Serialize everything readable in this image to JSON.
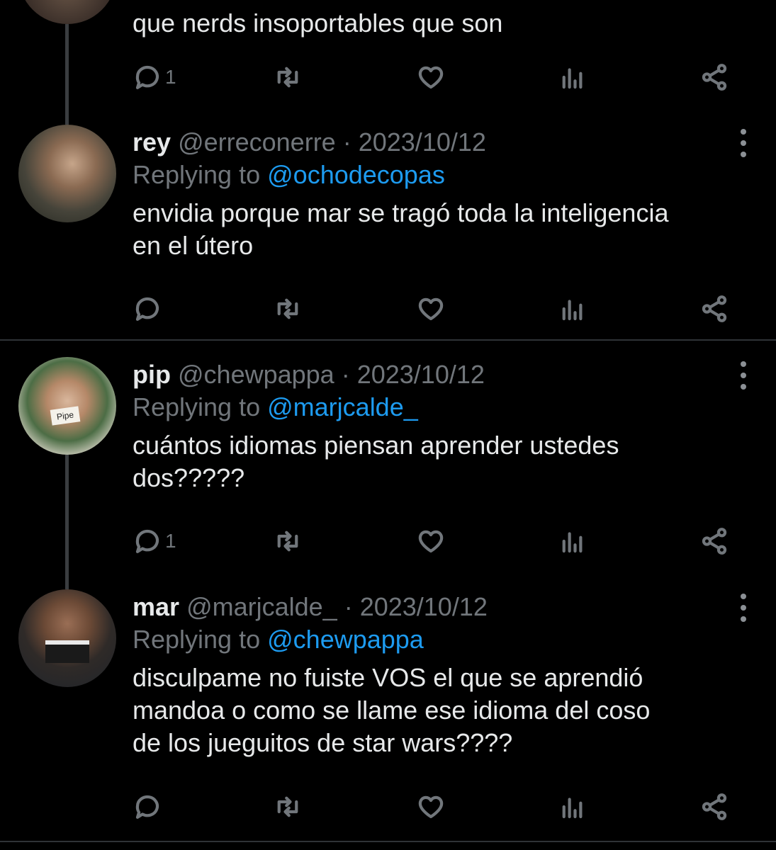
{
  "top_tweet": {
    "text": "que nerds insoportables que son",
    "reply_count": "1"
  },
  "tweets": [
    {
      "name": "rey",
      "handle": "@erreconerre",
      "date": "· 2023/10/12",
      "replying_prefix": "Replying to",
      "replying_to": "@ochodecopas",
      "body_line1": "envidia porque mar se tragó toda la inteligencia",
      "body_line2": "en el útero",
      "reply_count": ""
    },
    {
      "name": "pip",
      "handle": "@chewpappa",
      "date": "· 2023/10/12",
      "replying_prefix": "Replying to",
      "replying_to": "@marjcalde_",
      "body_line1": "cuántos idiomas piensan aprender ustedes",
      "body_line2": "dos?????",
      "avatar_note": "Pipe",
      "reply_count": "1"
    },
    {
      "name": "mar",
      "handle": "@marjcalde_",
      "date": "· 2023/10/12",
      "replying_prefix": "Replying to",
      "replying_to": "@chewpappa",
      "body_line1": "disculpame no fuiste VOS el que se aprendió",
      "body_line2": "mandoa o como se llame ese idioma del coso",
      "body_line3": "de los jueguitos de star wars????",
      "reply_count": ""
    }
  ],
  "icons": {
    "reply": "reply-icon",
    "retweet": "retweet-icon",
    "like": "heart-icon",
    "views": "analytics-icon",
    "share": "share-icon",
    "more": "more-icon"
  },
  "colors": {
    "background": "#000000",
    "text": "#e7e9ea",
    "secondary": "#71767b",
    "link": "#1d9bf0",
    "divider": "#2f3336"
  }
}
